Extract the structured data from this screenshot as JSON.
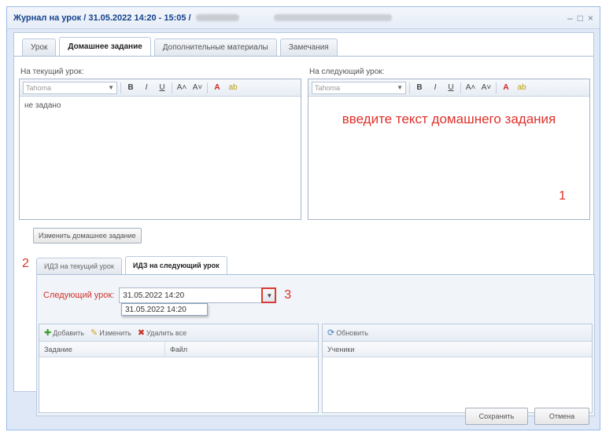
{
  "window": {
    "title": "Журнал на урок / 31.05.2022 14:20 - 15:05 /"
  },
  "tabs": [
    {
      "label": "Урок"
    },
    {
      "label": "Домашнее задание"
    },
    {
      "label": "Дополнительные материалы"
    },
    {
      "label": "Замечания"
    }
  ],
  "current_editor": {
    "label": "На текущий урок:",
    "font": "Tahoma",
    "text": "не задано"
  },
  "next_editor": {
    "label": "На следующий урок:",
    "font": "Tahoma",
    "placeholder": "введите текст домашнего задания"
  },
  "toolbar": {
    "bold": "B",
    "italic": "I",
    "underline": "U",
    "superscript": "A˄",
    "subscript": "A˅",
    "font_color": "A",
    "highlight": "ab"
  },
  "change_button": "Изменить домашнее задание",
  "subtabs": [
    {
      "label": "ИДЗ на текущий урок"
    },
    {
      "label": "ИДЗ на следующий урок"
    }
  ],
  "next_lesson": {
    "label": "Следующий урок:",
    "value": "31.05.2022 14:20",
    "dropdown_option": "31.05.2022 14:20"
  },
  "left_grid": {
    "toolbar": {
      "add": "Добавить",
      "edit": "Изменить",
      "delete": "Удалить все"
    },
    "columns": [
      "Задание",
      "Файл"
    ]
  },
  "right_grid": {
    "toolbar": {
      "refresh": "Обновить"
    },
    "columns": [
      "Ученики"
    ]
  },
  "annotations": [
    "1",
    "2",
    "3"
  ],
  "footer": {
    "save": "Сохранить",
    "cancel": "Отмена"
  },
  "colors": {
    "annotation": "#e0302a",
    "frame": "#99bbe8",
    "panel": "#dfe8f6"
  }
}
